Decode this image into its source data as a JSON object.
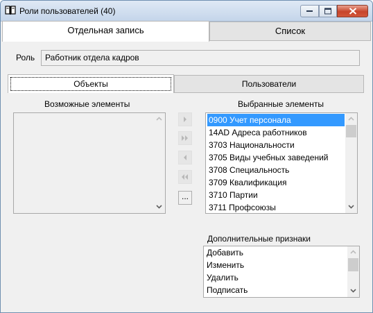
{
  "window": {
    "title": "Роли пользователей (40)",
    "icon": "book-icon"
  },
  "tabs": [
    {
      "label": "Отдельная запись",
      "active": true
    },
    {
      "label": "Список",
      "active": false
    }
  ],
  "role": {
    "label": "Роль",
    "value": "Работник отдела кадров"
  },
  "inner_tabs": [
    {
      "label": "Объекты",
      "active": true
    },
    {
      "label": "Пользователи",
      "active": false
    }
  ],
  "available": {
    "title": "Возможные элементы",
    "items": []
  },
  "selected": {
    "title": "Выбранные элементы",
    "items": [
      "0900 Учет персонала",
      "14AD Адреса работников",
      "3703 Национальности",
      "3705 Виды учебных заведений",
      "3708 Специальность",
      "3709 Квалификация",
      "3710 Партии",
      "3711 Профсоюзы"
    ],
    "selected_index": 0
  },
  "move_buttons": {
    "more_label": "..."
  },
  "extra": {
    "title": "Дополнительные признаки",
    "items": [
      "Добавить",
      "Изменить",
      "Удалить",
      "Подписать"
    ]
  },
  "colors": {
    "selection": "#3399ff",
    "close_button": "#c7452b"
  }
}
